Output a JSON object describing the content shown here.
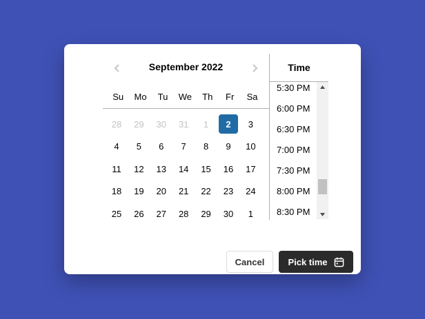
{
  "calendar": {
    "month_title": "September 2022",
    "weekdays": [
      "Su",
      "Mo",
      "Tu",
      "We",
      "Th",
      "Fr",
      "Sa"
    ],
    "weeks": [
      [
        {
          "d": "28",
          "out": true
        },
        {
          "d": "29",
          "out": true
        },
        {
          "d": "30",
          "out": true
        },
        {
          "d": "31",
          "out": true
        },
        {
          "d": "1",
          "out": true
        },
        {
          "d": "2",
          "sel": true
        },
        {
          "d": "3"
        }
      ],
      [
        {
          "d": "4"
        },
        {
          "d": "5"
        },
        {
          "d": "6"
        },
        {
          "d": "7"
        },
        {
          "d": "8"
        },
        {
          "d": "9"
        },
        {
          "d": "10"
        }
      ],
      [
        {
          "d": "11"
        },
        {
          "d": "12"
        },
        {
          "d": "13"
        },
        {
          "d": "14"
        },
        {
          "d": "15"
        },
        {
          "d": "16"
        },
        {
          "d": "17"
        }
      ],
      [
        {
          "d": "18"
        },
        {
          "d": "19"
        },
        {
          "d": "20"
        },
        {
          "d": "21"
        },
        {
          "d": "22"
        },
        {
          "d": "23"
        },
        {
          "d": "24"
        }
      ],
      [
        {
          "d": "25"
        },
        {
          "d": "26"
        },
        {
          "d": "27"
        },
        {
          "d": "28"
        },
        {
          "d": "29"
        },
        {
          "d": "30"
        },
        {
          "d": "1"
        }
      ]
    ]
  },
  "time": {
    "header": "Time",
    "items": [
      "5:30 PM",
      "6:00 PM",
      "6:30 PM",
      "7:00 PM",
      "7:30 PM",
      "8:00 PM",
      "8:30 PM"
    ],
    "scroll_position": 0.85
  },
  "footer": {
    "cancel_label": "Cancel",
    "pick_label": "Pick time"
  },
  "colors": {
    "background": "#3f51b5",
    "selected_day": "#216ba5",
    "outside_day": "#c2c2c2",
    "primary_button": "#2b2b2b"
  },
  "icons": {
    "prev": "chevron-left-icon",
    "next": "chevron-right-icon",
    "pick": "calendar-icon"
  }
}
